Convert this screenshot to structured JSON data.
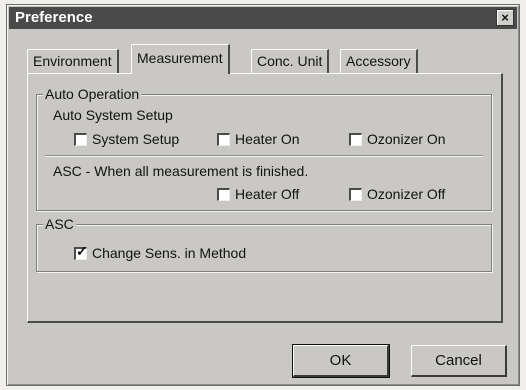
{
  "window": {
    "title": "Preference",
    "close_glyph": "×"
  },
  "tabs": [
    {
      "label": "Environment",
      "active": false
    },
    {
      "label": "Measurement",
      "active": true
    },
    {
      "label": "Conc. Unit",
      "active": false
    },
    {
      "label": "Accessory",
      "active": false
    }
  ],
  "auto_operation": {
    "legend": "Auto Operation",
    "system_setup_label": "Auto System Setup",
    "system_setup": {
      "label": "System Setup",
      "checked": false
    },
    "heater_on": {
      "label": "Heater On",
      "checked": false
    },
    "ozonizer_on": {
      "label": "Ozonizer On",
      "checked": false
    },
    "asc_label": "ASC - When all measurement is finished.",
    "heater_off": {
      "label": "Heater Off",
      "checked": false
    },
    "ozonizer_off": {
      "label": "Ozonizer Off",
      "checked": false
    }
  },
  "asc": {
    "legend": "ASC",
    "change_sens": {
      "label": "Change Sens. in Method",
      "checked": true
    }
  },
  "buttons": {
    "ok": "OK",
    "cancel": "Cancel"
  }
}
